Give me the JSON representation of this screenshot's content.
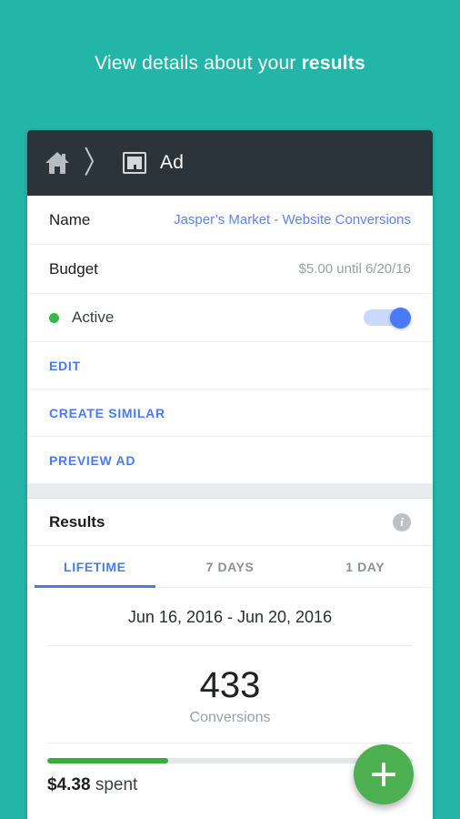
{
  "headline": {
    "prefix": "View details about your ",
    "emphasis": "results"
  },
  "breadcrumb": {
    "home_icon": "home-icon",
    "separator": "〉",
    "ad_icon": "ad-layout-icon",
    "title": "Ad"
  },
  "details": {
    "name": {
      "label": "Name",
      "value": "Jasper’s Market - Website Conversions"
    },
    "budget": {
      "label": "Budget",
      "value": "$5.00 until 6/20/16"
    },
    "status": {
      "label": "Active",
      "dot_color": "#34b94a",
      "toggle_on": true
    }
  },
  "actions": [
    {
      "label": "EDIT",
      "name": "edit-action"
    },
    {
      "label": "CREATE SIMILAR",
      "name": "create-similar-action"
    },
    {
      "label": "PREVIEW AD",
      "name": "preview-ad-action"
    }
  ],
  "results": {
    "title": "Results",
    "info_icon": "info-icon",
    "info_glyph": "i",
    "tabs": [
      {
        "label": "LIFETIME",
        "active": true
      },
      {
        "label": "7 DAYS",
        "active": false
      },
      {
        "label": "1 DAY",
        "active": false
      }
    ],
    "date_range": "Jun 16, 2016 - Jun 20, 2016",
    "metric_value": "433",
    "metric_label": "Conversions",
    "spend": {
      "amount": "$4.38",
      "suffix": " spent",
      "progress_percent": 33
    }
  },
  "fab": {
    "name": "add-button",
    "icon": "plus-icon"
  },
  "colors": {
    "background_teal": "#22b5a8",
    "header_dark": "#2b333b",
    "link_blue": "#4a7bf7",
    "status_green": "#34b94a",
    "progress_green": "#3aab3f",
    "fab_green": "#4caf50"
  }
}
